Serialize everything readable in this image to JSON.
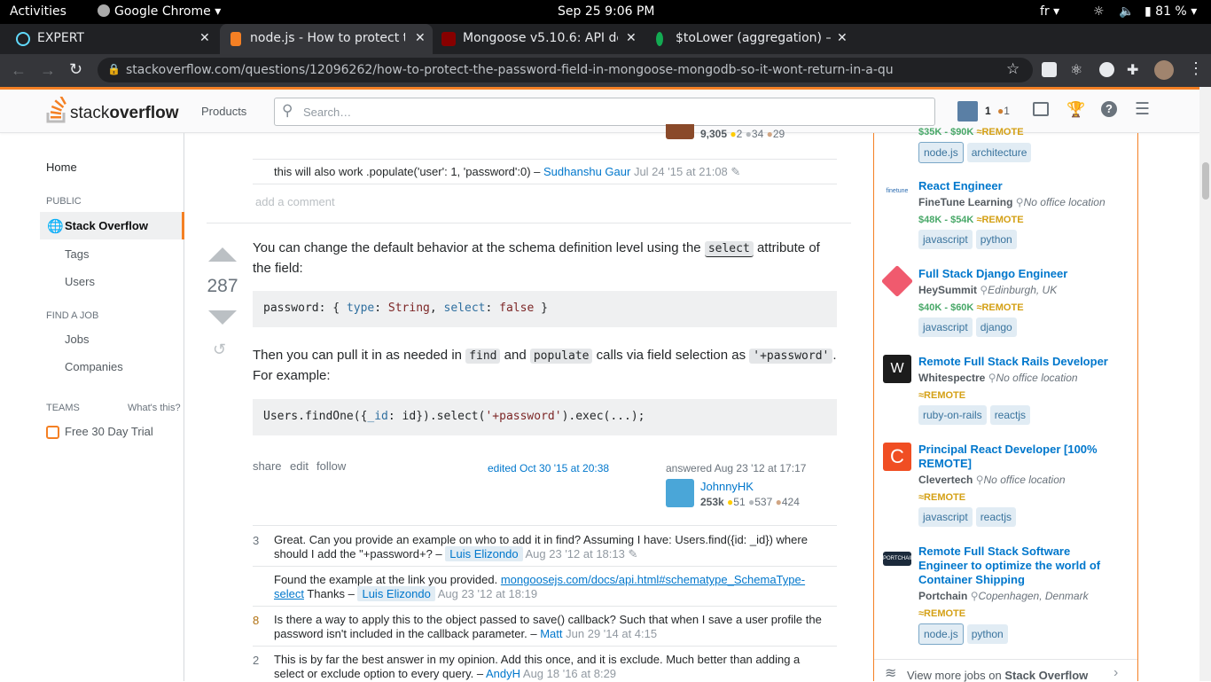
{
  "system": {
    "activities": "Activities",
    "app_menu": "Google Chrome",
    "clock": "Sep 25  9:06 PM",
    "lang": "fr",
    "battery": "81 %"
  },
  "tabs": [
    {
      "label": "EXPERT",
      "fav_color": "#61dafb"
    },
    {
      "label": "node.js - How to protect t",
      "fav_color": "#f48024"
    },
    {
      "label": "Mongoose v5.10.6: API do",
      "fav_color": "#880000"
    },
    {
      "label": "$toLower (aggregation) –",
      "fav_color": "#13aa52"
    }
  ],
  "browser": {
    "url": "stackoverflow.com/questions/12096262/how-to-protect-the-password-field-in-mongoose-mongodb-so-it-wont-return-in-a-qu"
  },
  "so_header": {
    "logo_a": "stack",
    "logo_b": "overflow",
    "products": "Products",
    "search_placeholder": "Search…",
    "rep": "1",
    "bronze": "1"
  },
  "leftnav": {
    "home": "Home",
    "public": "PUBLIC",
    "stackoverflow": "Stack Overflow",
    "tags": "Tags",
    "users": "Users",
    "find_job": "FIND A JOB",
    "jobs": "Jobs",
    "companies": "Companies",
    "teams": "TEAMS",
    "whats_this": "What's this?",
    "trial": "Free 30 Day Trial"
  },
  "prev": {
    "rep": "9,305",
    "gold": "2",
    "silver": "34",
    "bronze": "29",
    "comment_text": "this will also work .populate('user': 1, 'password':0) –",
    "comment_user": "Sudhanshu Gaur",
    "comment_date": "Jul 24 '15 at 21:08",
    "add_comment": "add a comment"
  },
  "answer": {
    "votes": "287",
    "p1a": "You can change the default behavior at the schema definition level using the",
    "p1code": "select",
    "p1b": "attribute of the field:",
    "code1_a": "password",
    "code1_b": ": { ",
    "code1_c": "type",
    "code1_d": ": ",
    "code1_e": "String",
    "code1_f": ", ",
    "code1_g": "select",
    "code1_h": ": ",
    "code1_i": "false",
    "code1_j": " }",
    "p2a": "Then you can pull it in as needed in",
    "p2c1": "find",
    "p2b": "and",
    "p2c2": "populate",
    "p2c": "calls via field selection as",
    "p2c3": "'+password'",
    "p2d": ".",
    "p2e": "For example:",
    "code2_a": "Users.findOne({",
    "code2_b": "_id",
    "code2_c": ": id}).select(",
    "code2_d": "'+password'",
    "code2_e": ").exec(...);",
    "share": "share",
    "edit": "edit",
    "follow": "follow",
    "edited": "edited Oct 30 '15 at 20:38",
    "answered": "answered Aug 23 '12 at 17:17",
    "author": "JohnnyHK",
    "author_rep": "253k",
    "gold": "51",
    "silver": "537",
    "bronze": "424"
  },
  "comments": [
    {
      "score": "3",
      "text": "Great. Can you provide an example on who to add it in find? Assuming I have: Users.find({id: _id}) where should I add the \"+password+? –",
      "user": "Luis Elizondo",
      "date": "Aug 23 '12 at 18:13"
    },
    {
      "score": "",
      "text_a": "Found the example at the link you provided.",
      "link_a": "mongoosejs.com/docs/api.html#schematype_SchemaType-",
      "link_b": "select",
      "text_b": "Thanks –",
      "user": "Luis Elizondo",
      "date": "Aug 23 '12 at 18:19"
    },
    {
      "score": "8",
      "text": "Is there a way to apply this to the object passed to save() callback? Such that when I save a user profile the password isn't included in the callback parameter. –",
      "user": "Matt",
      "date": "Jun 29 '14 at 4:15"
    },
    {
      "score": "2",
      "text": "This is by far the best answer in my opinion. Add this once, and it is exclude. Much better than adding a select or exclude option to every query. –",
      "user": "AndyH",
      "date": "Aug 18 '16 at 8:29"
    }
  ],
  "jobs": {
    "top_salary": "$35K - $90K",
    "top_remote": "REMOTE",
    "top_tags": [
      "node.js",
      "architecture"
    ],
    "list": [
      {
        "title": "React Engineer",
        "company": "FineTune Learning",
        "location": "No office location",
        "salary": "$48K - $54K",
        "remote": "REMOTE",
        "tags": [
          "javascript",
          "python"
        ]
      },
      {
        "title": "Full Stack Django Engineer",
        "company": "HeySummit",
        "location": "Edinburgh, UK",
        "salary": "$40K - $60K",
        "remote": "REMOTE",
        "tags": [
          "javascript",
          "django"
        ]
      },
      {
        "title": "Remote Full Stack Rails Developer",
        "company": "Whitespectre",
        "location": "No office location",
        "salary": "",
        "remote": "REMOTE",
        "tags": [
          "ruby-on-rails",
          "reactjs"
        ]
      },
      {
        "title": "Principal React Developer [100% REMOTE]",
        "company": "Clevertech",
        "location": "No office location",
        "salary": "",
        "remote": "REMOTE",
        "tags": [
          "javascript",
          "reactjs"
        ]
      },
      {
        "title": "Remote Full Stack Software Engineer to optimize the world of Container Shipping",
        "company": "Portchain",
        "location": "Copenhagen, Denmark",
        "salary": "",
        "remote": "REMOTE",
        "tags": [
          "node.js",
          "python"
        ]
      }
    ],
    "view_more_a": "View more jobs on",
    "view_more_b": "Stack Overflow"
  }
}
